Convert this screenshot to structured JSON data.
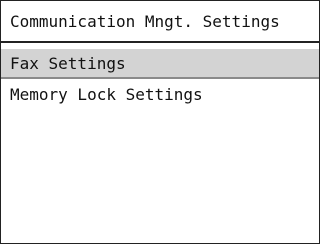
{
  "screen": {
    "title": "Communication Mngt. Settings"
  },
  "menu": {
    "items": [
      {
        "label": "Fax Settings",
        "selected": true
      },
      {
        "label": "Memory Lock Settings",
        "selected": false
      }
    ]
  },
  "colors": {
    "selected_background": "#d3d3d3",
    "border": "#222222"
  }
}
